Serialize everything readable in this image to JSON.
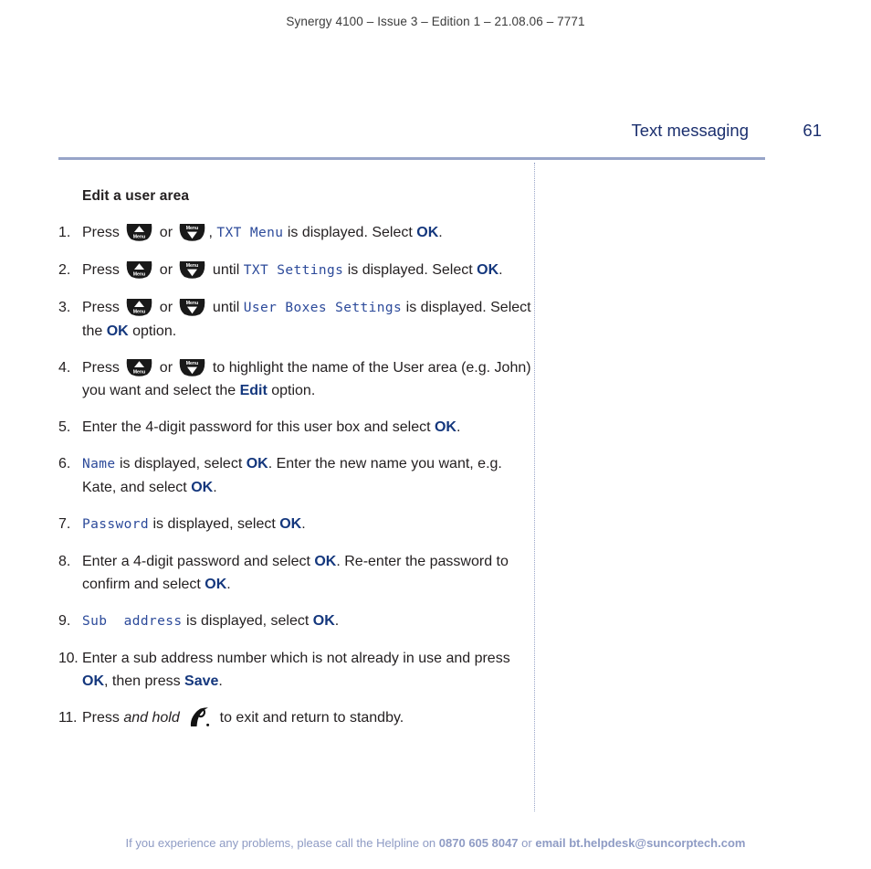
{
  "document": {
    "running_head": "Synergy 4100 – Issue 3 – Edition 1 – 21.08.06 – 7771",
    "chapter_title": "Text messaging",
    "page_number": "61",
    "section_heading": "Edit a user area",
    "colors": {
      "rule": "#97a4c8",
      "chapter_title": "#1b2f6e",
      "ui_bold": "#14377d",
      "lcd_text": "#2c4a9a",
      "body_text": "#231f20",
      "footer_text": "#8e9bc4",
      "key_icon": "#1a1a1a"
    }
  },
  "steps": [
    {
      "num": "1.",
      "parts": [
        {
          "t": "text",
          "v": "Press "
        },
        {
          "t": "key",
          "v": "up-menu-key"
        },
        {
          "t": "text",
          "v": " or "
        },
        {
          "t": "key",
          "v": "down-menu-key"
        },
        {
          "t": "text",
          "v": ", "
        },
        {
          "t": "lcd",
          "v": "TXT Menu"
        },
        {
          "t": "text",
          "v": " is displayed. Select "
        },
        {
          "t": "ui",
          "v": "OK"
        },
        {
          "t": "text",
          "v": "."
        }
      ]
    },
    {
      "num": "2.",
      "parts": [
        {
          "t": "text",
          "v": "Press "
        },
        {
          "t": "key",
          "v": "up-menu-key"
        },
        {
          "t": "text",
          "v": " or "
        },
        {
          "t": "key",
          "v": "down-menu-key"
        },
        {
          "t": "text",
          "v": " until "
        },
        {
          "t": "lcd",
          "v": "TXT Settings"
        },
        {
          "t": "text",
          "v": " is displayed. Select "
        },
        {
          "t": "ui",
          "v": "OK"
        },
        {
          "t": "text",
          "v": "."
        }
      ]
    },
    {
      "num": "3.",
      "parts": [
        {
          "t": "text",
          "v": "Press "
        },
        {
          "t": "key",
          "v": "up-menu-key"
        },
        {
          "t": "text",
          "v": " or "
        },
        {
          "t": "key",
          "v": "down-menu-key"
        },
        {
          "t": "text",
          "v": " until "
        },
        {
          "t": "lcd",
          "v": "User Boxes Settings"
        },
        {
          "t": "text",
          "v": " is displayed. Select the "
        },
        {
          "t": "ui",
          "v": "OK"
        },
        {
          "t": "text",
          "v": " option."
        }
      ]
    },
    {
      "num": "4.",
      "parts": [
        {
          "t": "text",
          "v": "Press "
        },
        {
          "t": "key",
          "v": "up-menu-key"
        },
        {
          "t": "text",
          "v": " or "
        },
        {
          "t": "key",
          "v": "down-menu-key"
        },
        {
          "t": "text",
          "v": " to highlight the name of the User area (e.g. John) you want and select the "
        },
        {
          "t": "ui",
          "v": "Edit"
        },
        {
          "t": "text",
          "v": " option."
        }
      ]
    },
    {
      "num": "5.",
      "parts": [
        {
          "t": "text",
          "v": "Enter the 4-digit password for this user box and select "
        },
        {
          "t": "ui",
          "v": "OK"
        },
        {
          "t": "text",
          "v": "."
        }
      ]
    },
    {
      "num": "6.",
      "parts": [
        {
          "t": "lcd",
          "v": "Name"
        },
        {
          "t": "text",
          "v": " is displayed, select "
        },
        {
          "t": "ui",
          "v": "OK"
        },
        {
          "t": "text",
          "v": ". Enter the new name you want, e.g. Kate, and select "
        },
        {
          "t": "ui",
          "v": "OK"
        },
        {
          "t": "text",
          "v": "."
        }
      ]
    },
    {
      "num": "7.",
      "parts": [
        {
          "t": "lcd",
          "v": "Password"
        },
        {
          "t": "text",
          "v": " is displayed, select "
        },
        {
          "t": "ui",
          "v": "OK"
        },
        {
          "t": "text",
          "v": "."
        }
      ]
    },
    {
      "num": "8.",
      "parts": [
        {
          "t": "text",
          "v": "Enter a 4-digit password and select "
        },
        {
          "t": "ui",
          "v": "OK"
        },
        {
          "t": "text",
          "v": ". Re-enter the password to confirm and select "
        },
        {
          "t": "ui",
          "v": "OK"
        },
        {
          "t": "text",
          "v": "."
        }
      ]
    },
    {
      "num": "9.",
      "parts": [
        {
          "t": "lcd",
          "v": "Sub  address"
        },
        {
          "t": "text",
          "v": " is displayed, select "
        },
        {
          "t": "ui",
          "v": "OK"
        },
        {
          "t": "text",
          "v": "."
        }
      ]
    },
    {
      "num": "10.",
      "parts": [
        {
          "t": "text",
          "v": "Enter a sub address number which is not already in use and press "
        },
        {
          "t": "ui",
          "v": "OK"
        },
        {
          "t": "text",
          "v": ", then press "
        },
        {
          "t": "ui",
          "v": "Save"
        },
        {
          "t": "text",
          "v": "."
        }
      ]
    },
    {
      "num": "11.",
      "parts": [
        {
          "t": "text",
          "v": "Press "
        },
        {
          "t": "em",
          "v": "and hold"
        },
        {
          "t": "text",
          "v": " "
        },
        {
          "t": "key",
          "v": "handset-end-call-key"
        },
        {
          "t": "text",
          "v": " to exit and return to standby."
        }
      ]
    }
  ],
  "footer": {
    "lead": "If you experience any problems, please call the Helpline on ",
    "phone": "0870 605 8047",
    "mid": " or ",
    "email": "email bt.helpdesk@suncorptech.com"
  },
  "key_labels": {
    "menu": "Menu"
  }
}
